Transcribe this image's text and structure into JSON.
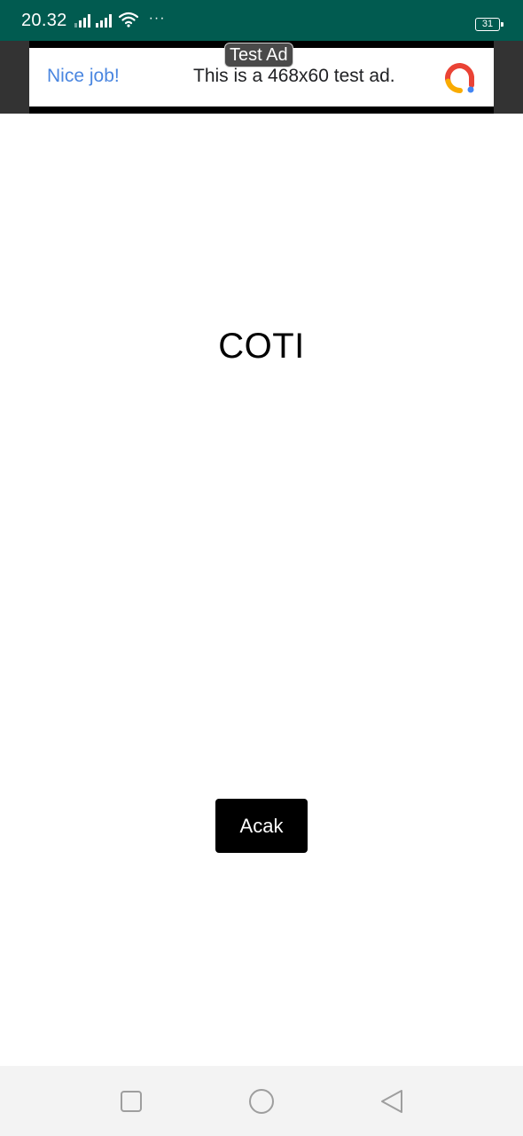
{
  "colors": {
    "status_bar_bg": "#015b50",
    "ad_cta": "#4a86e0",
    "button_bg": "#000000",
    "nav_bg": "#f3f3f3",
    "nav_icon": "#9e9e9e"
  },
  "status_bar": {
    "time": "20.32",
    "more": "···",
    "battery_level": "31",
    "icons": [
      "signal-icon",
      "signal-icon",
      "wifi-icon",
      "battery-icon"
    ]
  },
  "ad": {
    "label": "Test Ad",
    "cta": "Nice job!",
    "text": "This is a 468x60 test ad.",
    "logo": "ad-network-logo-icon"
  },
  "main": {
    "word": "COTI",
    "shuffle_button": "Acak"
  },
  "nav_bar": {
    "icons": [
      "recent-apps-icon",
      "home-icon",
      "back-icon"
    ]
  }
}
